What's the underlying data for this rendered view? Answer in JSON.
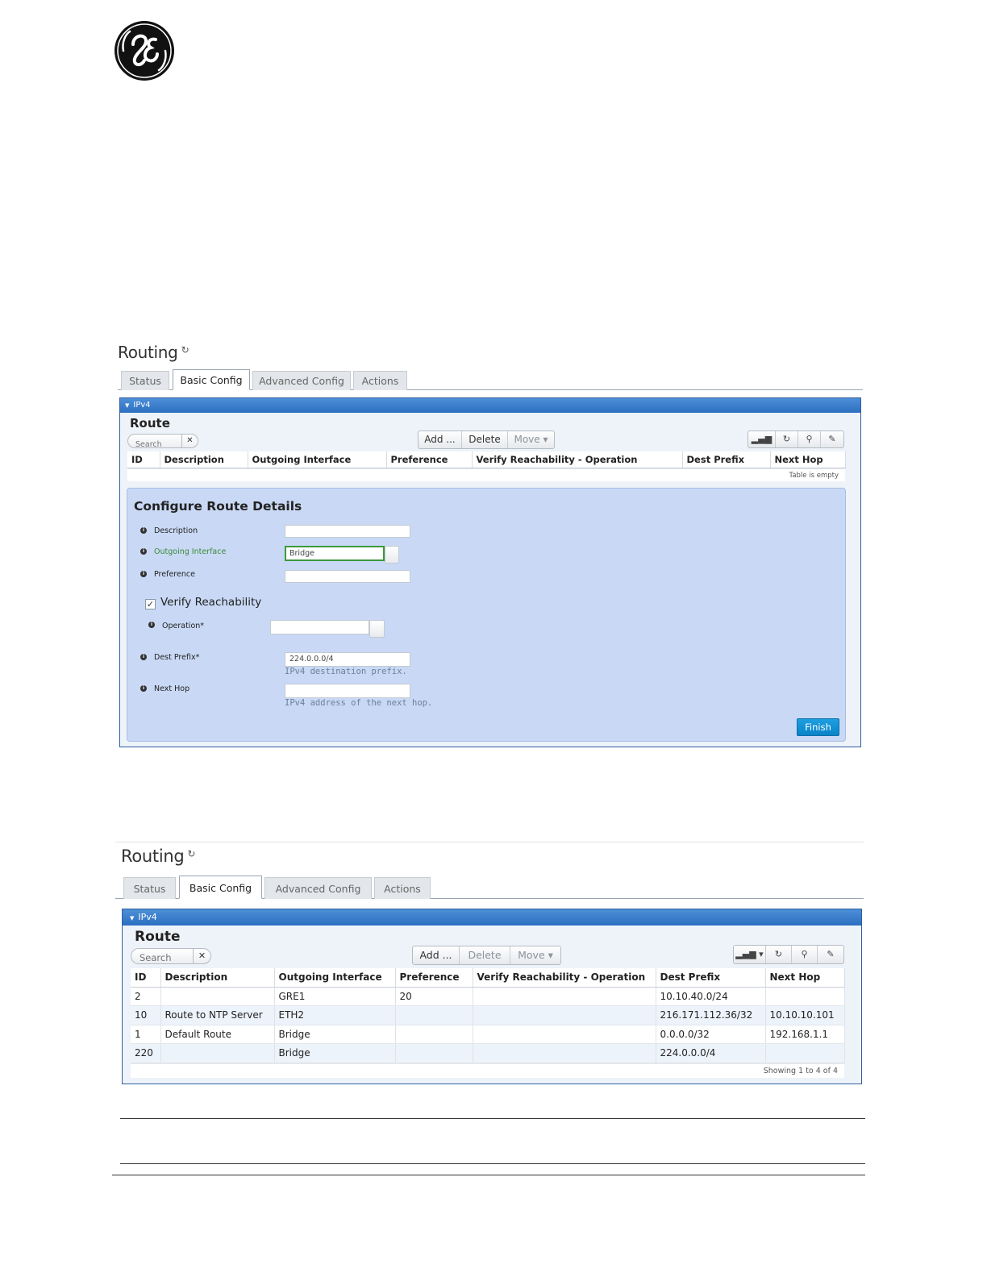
{
  "screens": [
    {
      "title": "Routing",
      "tabs": [
        "Status",
        "Basic Config",
        "Advanced Config",
        "Actions"
      ],
      "active_tab": "Basic Config",
      "panel_header": "IPv4",
      "section_title": "Route",
      "search_placeholder": "Search",
      "buttons": {
        "add": "Add ...",
        "delete": "Delete",
        "move": "Move ▾"
      },
      "columns": [
        "ID",
        "Description",
        "Outgoing Interface",
        "Preference",
        "Verify Reachability - Operation",
        "Dest Prefix",
        "Next Hop"
      ],
      "footer": "Table is empty",
      "form": {
        "title": "Configure Route Details",
        "description_label": "Description",
        "description_value": "",
        "outgoing_label": "Outgoing Interface",
        "outgoing_value": "Bridge",
        "preference_label": "Preference",
        "preference_value": "",
        "verify_label": "Verify Reachability",
        "verify_checked": true,
        "operation_label": "Operation*",
        "operation_value": "",
        "dest_label": "Dest Prefix*",
        "dest_value": "224.0.0.0/4",
        "dest_hint": "IPv4 destination prefix.",
        "next_hop_label": "Next Hop",
        "next_hop_value": "",
        "next_hop_hint": "IPv4 address of the next hop.",
        "finish": "Finish"
      }
    },
    {
      "title": "Routing",
      "tabs": [
        "Status",
        "Basic Config",
        "Advanced Config",
        "Actions"
      ],
      "active_tab": "Basic Config",
      "panel_header": "IPv4",
      "section_title": "Route",
      "search_placeholder": "Search",
      "buttons": {
        "add": "Add ...",
        "delete": "Delete",
        "move": "Move ▾"
      },
      "columns": [
        "ID",
        "Description",
        "Outgoing Interface",
        "Preference",
        "Verify Reachability - Operation",
        "Dest Prefix",
        "Next Hop"
      ],
      "rows": [
        [
          "2",
          "",
          "GRE1",
          "20",
          "",
          "10.10.40.0/24",
          ""
        ],
        [
          "10",
          "Route to NTP Server",
          "ETH2",
          "",
          "",
          "216.171.112.36/32",
          "10.10.10.101"
        ],
        [
          "1",
          "Default Route",
          "Bridge",
          "",
          "",
          "0.0.0.0/32",
          "192.168.1.1"
        ],
        [
          "220",
          "",
          "Bridge",
          "",
          "",
          "224.0.0.0/4",
          ""
        ]
      ],
      "footer": "Showing 1 to 4 of 4"
    }
  ],
  "icons": {
    "refresh": "↻",
    "chart": "chart-icon",
    "search": "search-icon",
    "wrench": "wrench-icon"
  },
  "colors": {
    "panel_header": "#2c6fc0",
    "config_background": "#c9d9f5",
    "finish_button": "#0a83c8",
    "focus_border": "#3b9a3b"
  }
}
